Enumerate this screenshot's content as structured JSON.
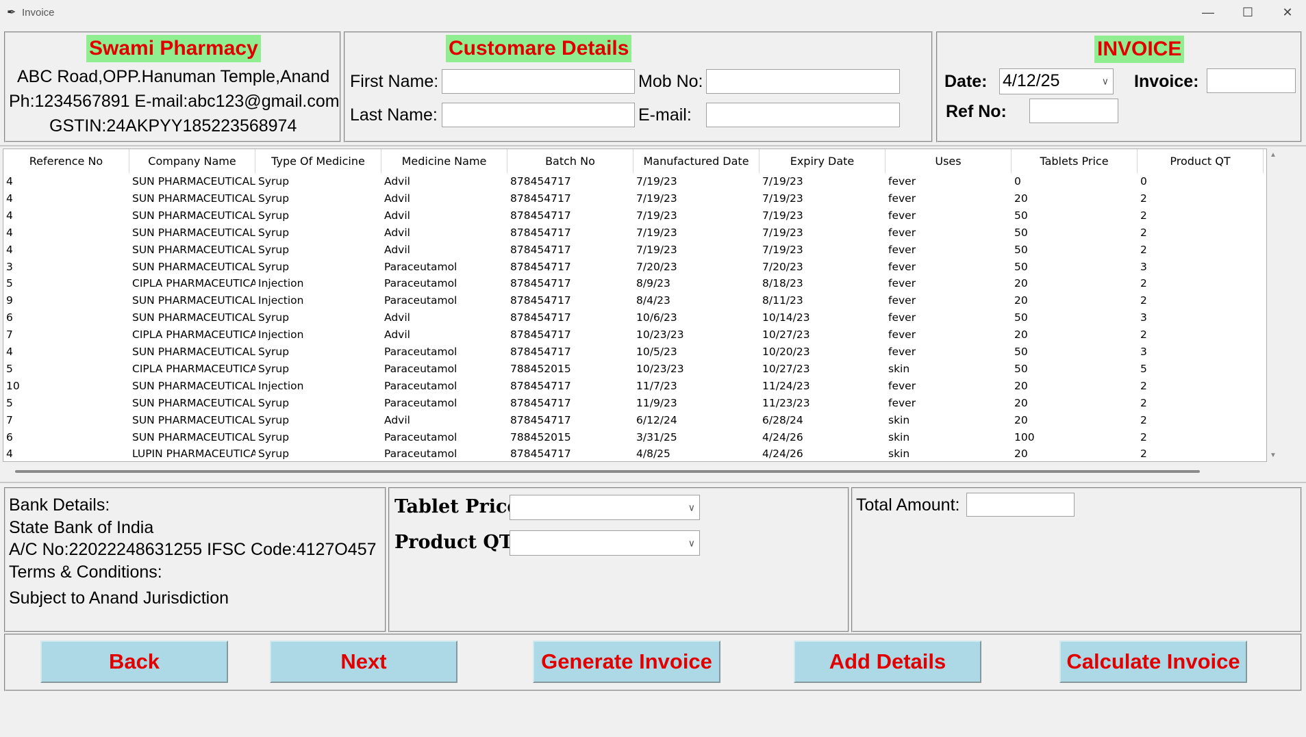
{
  "window": {
    "title": "Invoice",
    "minimize": "—",
    "maximize": "☐",
    "close": "✕"
  },
  "pharmacy": {
    "name": "Swami Pharmacy",
    "address": "ABC Road,OPP.Hanuman Temple,Anand",
    "contact": "Ph:1234567891 E-mail:abc123@gmail.com",
    "gstin": "GSTIN:24AKPYY185223568974"
  },
  "customer": {
    "title": "Customare Details",
    "first_name_label": "First Name:",
    "first_name_value": "",
    "last_name_label": "Last Name:",
    "last_name_value": "",
    "mob_label": "Mob No:",
    "mob_value": "",
    "email_label": "E-mail:",
    "email_value": ""
  },
  "invoice": {
    "title": "INVOICE",
    "date_label": "Date:",
    "date_value": "4/12/25",
    "invoice_label": "Invoice:",
    "invoice_value": "",
    "ref_label": "Ref No:",
    "ref_value": ""
  },
  "table": {
    "columns": [
      "Reference No",
      "Company Name",
      "Type Of Medicine",
      "Medicine Name",
      "Batch No",
      "Manufactured Date",
      "Expiry Date",
      "Uses",
      "Tablets Price",
      "Product QT"
    ],
    "rows": [
      [
        "4",
        "SUN PHARMACEUTICAL",
        "Syrup",
        "Advil",
        "878454717",
        "7/19/23",
        "7/19/23",
        "fever",
        "0",
        "0"
      ],
      [
        "4",
        "SUN PHARMACEUTICAL",
        "Syrup",
        "Advil",
        "878454717",
        "7/19/23",
        "7/19/23",
        "fever",
        "20",
        "2"
      ],
      [
        "4",
        "SUN PHARMACEUTICAL",
        "Syrup",
        "Advil",
        "878454717",
        "7/19/23",
        "7/19/23",
        "fever",
        "50",
        "2"
      ],
      [
        "4",
        "SUN PHARMACEUTICAL",
        "Syrup",
        "Advil",
        "878454717",
        "7/19/23",
        "7/19/23",
        "fever",
        "50",
        "2"
      ],
      [
        "4",
        "SUN PHARMACEUTICAL",
        "Syrup",
        "Advil",
        "878454717",
        "7/19/23",
        "7/19/23",
        "fever",
        "50",
        "2"
      ],
      [
        "3",
        "SUN PHARMACEUTICAL",
        "Syrup",
        "Paraceutamol",
        "878454717",
        "7/20/23",
        "7/20/23",
        "fever",
        "50",
        "3"
      ],
      [
        "5",
        "CIPLA PHARMACEUTICA",
        "Injection",
        "Paraceutamol",
        "878454717",
        "8/9/23",
        "8/18/23",
        "fever",
        "20",
        "2"
      ],
      [
        "9",
        "SUN PHARMACEUTICAL",
        "Injection",
        "Paraceutamol",
        "878454717",
        "8/4/23",
        "8/11/23",
        "fever",
        "20",
        "2"
      ],
      [
        "6",
        "SUN PHARMACEUTICAL",
        "Syrup",
        "Advil",
        "878454717",
        "10/6/23",
        "10/14/23",
        "fever",
        "50",
        "3"
      ],
      [
        "7",
        "CIPLA PHARMACEUTICA",
        "Injection",
        "Advil",
        "878454717",
        "10/23/23",
        "10/27/23",
        "fever",
        "20",
        "2"
      ],
      [
        "4",
        "SUN PHARMACEUTICAL",
        "Syrup",
        "Paraceutamol",
        "878454717",
        "10/5/23",
        "10/20/23",
        "fever",
        "50",
        "3"
      ],
      [
        "5",
        "CIPLA PHARMACEUTICA",
        "Syrup",
        "Paraceutamol",
        "788452015",
        "10/23/23",
        "10/27/23",
        "skin",
        "50",
        "5"
      ],
      [
        "10",
        "SUN PHARMACEUTICAL",
        "Injection",
        "Paraceutamol",
        "878454717",
        "11/7/23",
        "11/24/23",
        "fever",
        "20",
        "2"
      ],
      [
        "5",
        "SUN PHARMACEUTICAL",
        "Syrup",
        "Paraceutamol",
        "878454717",
        "11/9/23",
        "11/23/23",
        "fever",
        "20",
        "2"
      ],
      [
        "7",
        "SUN PHARMACEUTICAL",
        "Syrup",
        "Advil",
        "878454717",
        "6/12/24",
        "6/28/24",
        "skin",
        "20",
        "2"
      ],
      [
        "6",
        "SUN PHARMACEUTICAL",
        "Syrup",
        "Paraceutamol",
        "788452015",
        "3/31/25",
        "4/24/26",
        "skin",
        "100",
        "2"
      ],
      [
        "4",
        "LUPIN PHARMACEUTICA",
        "Syrup",
        "Paraceutamol",
        "878454717",
        "4/8/25",
        "4/24/26",
        "skin",
        "20",
        "2"
      ]
    ]
  },
  "bank": {
    "heading": "Bank Details:",
    "bank_name": "State Bank of India",
    "account": "A/C No:22022248631255  IFSC Code:4127O457",
    "terms_heading": "Terms & Conditions:",
    "terms_text": "Subject to Anand Jurisdiction"
  },
  "pricing": {
    "tablet_price_label": "Tablet Price:",
    "tablet_price_value": "",
    "product_qt_label": "Product QT:",
    "product_qt_value": ""
  },
  "totals": {
    "total_label": "Total Amount:",
    "total_value": ""
  },
  "buttons": {
    "back": "Back",
    "next": "Next",
    "generate": "Generate Invoice",
    "add": "Add Details",
    "calculate": "Calculate Invoice"
  },
  "colors": {
    "title_bg": "#90ee90",
    "title_fg": "#e10000",
    "button_bg": "#add8e6",
    "button_fg": "#e10000"
  }
}
